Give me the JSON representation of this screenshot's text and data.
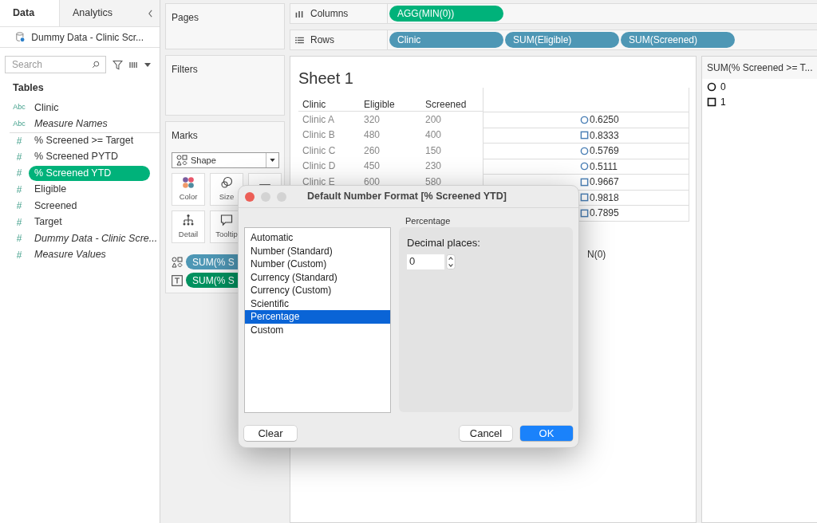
{
  "left_panel": {
    "tabs": [
      {
        "label": "Data",
        "selected": true
      },
      {
        "label": "Analytics",
        "selected": false
      }
    ],
    "datasource": "Dummy Data - Clinic Scr...",
    "search": {
      "placeholder": "Search"
    },
    "section": "Tables",
    "fields": [
      {
        "kind": "dimension",
        "icon": "Abc",
        "label": "Clinic",
        "italic": false,
        "selected": false
      },
      {
        "kind": "dimension",
        "icon": "Abc",
        "label": "Measure Names",
        "italic": true,
        "selected": false
      },
      {
        "kind": "measure",
        "icon": "#",
        "label": "% Screened >= Target",
        "italic": false,
        "selected": false
      },
      {
        "kind": "measure",
        "icon": "#",
        "label": "% Screened PYTD",
        "italic": false,
        "selected": false
      },
      {
        "kind": "measure",
        "icon": "#",
        "label": "% Screened YTD",
        "italic": false,
        "selected": true
      },
      {
        "kind": "measure",
        "icon": "#",
        "label": "Eligible",
        "italic": false,
        "selected": false
      },
      {
        "kind": "measure",
        "icon": "#",
        "label": "Screened",
        "italic": false,
        "selected": false
      },
      {
        "kind": "measure",
        "icon": "#",
        "label": "Target",
        "italic": false,
        "selected": false
      },
      {
        "kind": "measure",
        "icon": "#",
        "label": "Dummy Data - Clinic Scre...",
        "italic": true,
        "selected": false
      },
      {
        "kind": "measure",
        "icon": "#",
        "label": "Measure Values",
        "italic": true,
        "selected": false
      }
    ]
  },
  "pages": {
    "title": "Pages"
  },
  "filters": {
    "title": "Filters"
  },
  "marks": {
    "title": "Marks",
    "mark_type": "Shape",
    "cards": [
      {
        "kind": "color",
        "label": "Color"
      },
      {
        "kind": "size",
        "label": "Size"
      },
      {
        "kind": "text"
      },
      {
        "kind": "detail",
        "label": "Detail"
      },
      {
        "kind": "tooltip",
        "label": "Tooltip"
      }
    ],
    "pills": [
      {
        "kind": "shape",
        "label": "SUM(% S"
      },
      {
        "kind": "text",
        "label": "SUM(% S"
      }
    ]
  },
  "columns_shelf": {
    "label": "Columns",
    "pills": [
      {
        "label": "AGG(MIN(0))",
        "kind": "measure"
      }
    ]
  },
  "rows_shelf": {
    "label": "Rows",
    "pills": [
      {
        "label": "Clinic",
        "kind": "dimension"
      },
      {
        "label": "SUM(Eligible)",
        "kind": "dimension"
      },
      {
        "label": "SUM(Screened)",
        "kind": "dimension"
      }
    ]
  },
  "sheet": {
    "title": "Sheet 1",
    "headers": [
      "Clinic",
      "Eligible",
      "Screened"
    ],
    "rows": [
      {
        "clinic": "Clinic A",
        "eligible": "320",
        "screened": "200",
        "kind": "circle",
        "value": "0.6250"
      },
      {
        "clinic": "Clinic B",
        "eligible": "480",
        "screened": "400",
        "kind": "square",
        "value": "0.8333"
      },
      {
        "clinic": "Clinic C",
        "eligible": "260",
        "screened": "150",
        "kind": "circle",
        "value": "0.5769"
      },
      {
        "clinic": "Clinic D",
        "eligible": "450",
        "screened": "230",
        "kind": "circle",
        "value": "0.5111"
      },
      {
        "clinic": "Clinic E",
        "eligible": "600",
        "screened": "580",
        "kind": "square",
        "value": "0.9667"
      },
      {
        "kind": "square",
        "value": "0.9818"
      },
      {
        "kind": "square",
        "value": "0.7895"
      }
    ],
    "axis_label": "N(0)"
  },
  "legend": {
    "title": "SUM(% Screened >= T...",
    "items": [
      {
        "kind": "circle",
        "label": "0"
      },
      {
        "kind": "square",
        "label": "1"
      }
    ]
  },
  "dialog": {
    "title": "Default Number Format [% Screened YTD]",
    "formats": [
      {
        "label": "Automatic",
        "selected": false
      },
      {
        "label": "Number (Standard)",
        "selected": false
      },
      {
        "label": "Number (Custom)",
        "selected": false
      },
      {
        "label": "Currency (Standard)",
        "selected": false
      },
      {
        "label": "Currency (Custom)",
        "selected": false
      },
      {
        "label": "Scientific",
        "selected": false
      },
      {
        "label": "Percentage",
        "selected": true
      },
      {
        "label": "Custom",
        "selected": false
      }
    ],
    "panel_title": "Percentage",
    "decimal_label": "Decimal places:",
    "decimal_value": "0",
    "buttons": [
      {
        "kind": "secondary",
        "label": "Clear"
      },
      {
        "kind": "secondary",
        "label": "Cancel"
      },
      {
        "kind": "primary",
        "label": "OK"
      }
    ]
  }
}
